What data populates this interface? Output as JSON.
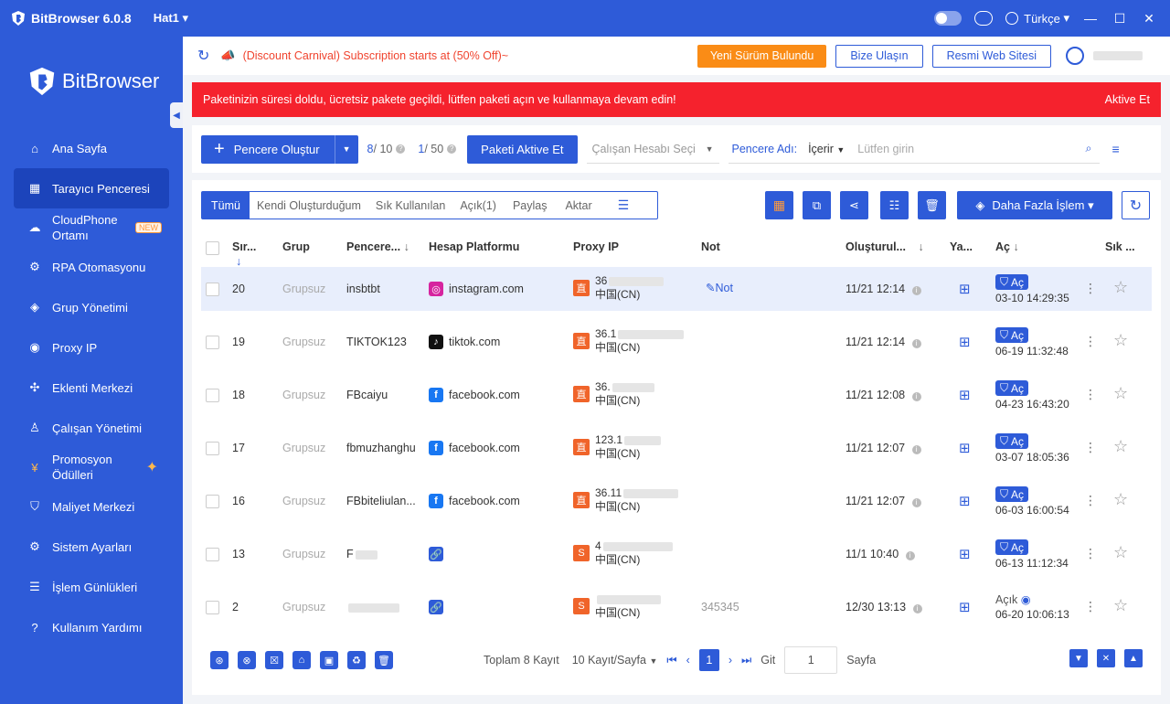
{
  "titlebar": {
    "app": "BitBrowser 6.0.8",
    "profile": "Hat1",
    "language": "Türkçe"
  },
  "sidebar": {
    "brand": "BitBrowser",
    "items": [
      {
        "label": "Ana Sayfa",
        "icon": "home-icon"
      },
      {
        "label": "Tarayıcı Penceresi",
        "icon": "grid-icon"
      },
      {
        "label": "CloudPhone Ortamı",
        "icon": "cloud-icon",
        "badge": "NEW"
      },
      {
        "label": "RPA Otomasyonu",
        "icon": "robot-icon"
      },
      {
        "label": "Grup Yönetimi",
        "icon": "layers-icon"
      },
      {
        "label": "Proxy IP",
        "icon": "location-icon"
      },
      {
        "label": "Eklenti Merkezi",
        "icon": "puzzle-icon"
      },
      {
        "label": "Çalışan Yönetimi",
        "icon": "users-icon"
      },
      {
        "label": "Promosyon Ödülleri",
        "icon": "coin-icon"
      },
      {
        "label": "Maliyet Merkezi",
        "icon": "shield-icon"
      },
      {
        "label": "Sistem Ayarları",
        "icon": "settings-icon"
      },
      {
        "label": "İşlem Günlükleri",
        "icon": "log-icon"
      },
      {
        "label": "Kullanım Yardımı",
        "icon": "help-icon"
      }
    ]
  },
  "topbar": {
    "promo": "(Discount Carnival)  Subscription starts at (50% Off)~",
    "update": "Yeni Sürüm Bulundu",
    "contact": "Bize Ulaşın",
    "website": "Resmi Web Sitesi"
  },
  "alert": {
    "message": "Paketinizin süresi doldu, ücretsiz pakete geçildi, lütfen paketi açın ve kullanmaya devam edin!",
    "action": "Aktive Et"
  },
  "toolbar": {
    "create": "Pencere Oluştur",
    "count_used": "8",
    "count_total": " / 10",
    "count2_used": "1",
    "count2_total": " / 50",
    "activate": "Paketi Aktive Et",
    "employee_placeholder": "Çalışan Hesabı Seçi",
    "filter_label": "Pencere Adı:",
    "filter_op": "İçerir",
    "search_placeholder": "Lütfen girin"
  },
  "tabs": [
    "Tümü",
    "Kendi Oluşturduğum",
    "Sık Kullanılan",
    "Açık(1)",
    "Paylaş",
    "Aktar"
  ],
  "more_actions": "Daha Fazla İşlem",
  "columns": {
    "seq": "Sır...",
    "group": "Grup",
    "window": "Pencere...",
    "platform": "Hesap Platformu",
    "proxy": "Proxy IP",
    "note": "Not",
    "created": "Oluşturul...",
    "os": "Ya...",
    "open": "Aç",
    "fav": "Sık ..."
  },
  "rows": [
    {
      "seq": "20",
      "group": "Grupsuz",
      "name": "insbtbt",
      "platform": "instagram.com",
      "pcolor": "#d6249f",
      "pletter": "◎",
      "ip1": "36",
      "ip2": "中国(CN)",
      "ptype": "直",
      "ptcolor": "#f0642a",
      "note": "Not",
      "created": "11/21 12:14",
      "open": "Aç",
      "opened": "03-10 14:29:35"
    },
    {
      "seq": "19",
      "group": "Grupsuz",
      "name": "TIKTOK123",
      "platform": "tiktok.com",
      "pcolor": "#111",
      "pletter": "♪",
      "ip1": "36.1",
      "ip2": "中国(CN)",
      "ptype": "直",
      "ptcolor": "#f0642a",
      "note": "",
      "created": "11/21 12:14",
      "open": "Aç",
      "opened": "06-19 11:32:48"
    },
    {
      "seq": "18",
      "group": "Grupsuz",
      "name": "FBcaiyu",
      "platform": "facebook.com",
      "pcolor": "#1877f2",
      "pletter": "f",
      "ip1": "36.",
      "ip2": "中国(CN)",
      "ptype": "直",
      "ptcolor": "#f0642a",
      "note": "",
      "created": "11/21 12:08",
      "open": "Aç",
      "opened": "04-23 16:43:20"
    },
    {
      "seq": "17",
      "group": "Grupsuz",
      "name": "fbmuzhanghu",
      "platform": "facebook.com",
      "pcolor": "#1877f2",
      "pletter": "f",
      "ip1": "123.1",
      "ip2": "中国(CN)",
      "ptype": "直",
      "ptcolor": "#f0642a",
      "note": "",
      "created": "11/21 12:07",
      "open": "Aç",
      "opened": "03-07 18:05:36"
    },
    {
      "seq": "16",
      "group": "Grupsuz",
      "name": "FBbiteliulan...",
      "platform": "facebook.com",
      "pcolor": "#1877f2",
      "pletter": "f",
      "ip1": "36.11",
      "ip2": "中国(CN)",
      "ptype": "直",
      "ptcolor": "#f0642a",
      "note": "",
      "created": "11/21 12:07",
      "open": "Aç",
      "opened": "06-03 16:00:54"
    },
    {
      "seq": "13",
      "group": "Grupsuz",
      "name": "F",
      "platform": "",
      "pcolor": "#2e5bd8",
      "pletter": "🔗",
      "ip1": "4",
      "ip2": "中国(CN)",
      "ptype": "S",
      "ptcolor": "#f0642a",
      "note": "",
      "created": "11/1 10:40",
      "open": "Aç",
      "opened": "06-13 11:12:34"
    },
    {
      "seq": "2",
      "group": "Grupsuz",
      "name": "",
      "platform": "",
      "pcolor": "#2e5bd8",
      "pletter": "🔗",
      "ip1": "",
      "ip2": "中国(CN)",
      "ptype": "S",
      "ptcolor": "#f0642a",
      "note": "345345",
      "created": "12/30 13:13",
      "open": "Açık",
      "opened": "06-20 10:06:13"
    }
  ],
  "pager": {
    "total": "Toplam 8 Kayıt",
    "per_page": "10 Kayıt/Sayfa",
    "page": "1",
    "goto": "Git",
    "page_input": "1",
    "page_suffix": "Sayfa"
  }
}
